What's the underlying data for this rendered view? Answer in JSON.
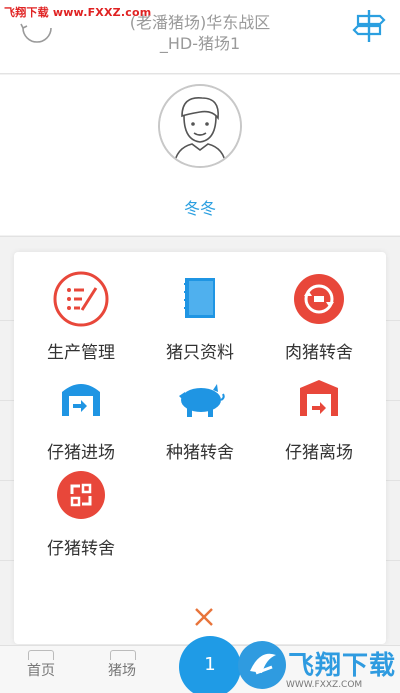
{
  "watermark": "飞翔下载 www.FXXZ.com",
  "header": {
    "title_line1": "(老潘猪场)华东战区",
    "title_line2": "_HD-猪场1",
    "left_icon": "refresh-arc-icon",
    "right_icon": "signpost-icon"
  },
  "profile": {
    "name": "冬冬",
    "avatar_icon": "user-avatar-icon"
  },
  "menu": {
    "items": [
      {
        "label": "生产管理",
        "icon": "production-icon",
        "color": "#e8473a"
      },
      {
        "label": "猪只资料",
        "icon": "notebook-icon",
        "color": "#1f95e3"
      },
      {
        "label": "肉猪转舍",
        "icon": "transfer-circle-icon",
        "color": "#e8473a"
      },
      {
        "label": "仔猪进场",
        "icon": "barn-in-icon",
        "color": "#1f95e3"
      },
      {
        "label": "种猪转舍",
        "icon": "pig-icon",
        "color": "#1f95e3"
      },
      {
        "label": "仔猪离场",
        "icon": "barn-out-icon",
        "color": "#e8473a"
      },
      {
        "label": "仔猪转舍",
        "icon": "swap-circle-icon",
        "color": "#e8473a"
      }
    ],
    "close_icon": "close-icon",
    "close_color": "#e8743a"
  },
  "bottom_nav": {
    "tab_home": "首页",
    "tab_farm": "猪场",
    "fab_label": "1"
  },
  "logo": {
    "text": "飞翔下载",
    "sub": "WWW.FXXZ.COM"
  }
}
